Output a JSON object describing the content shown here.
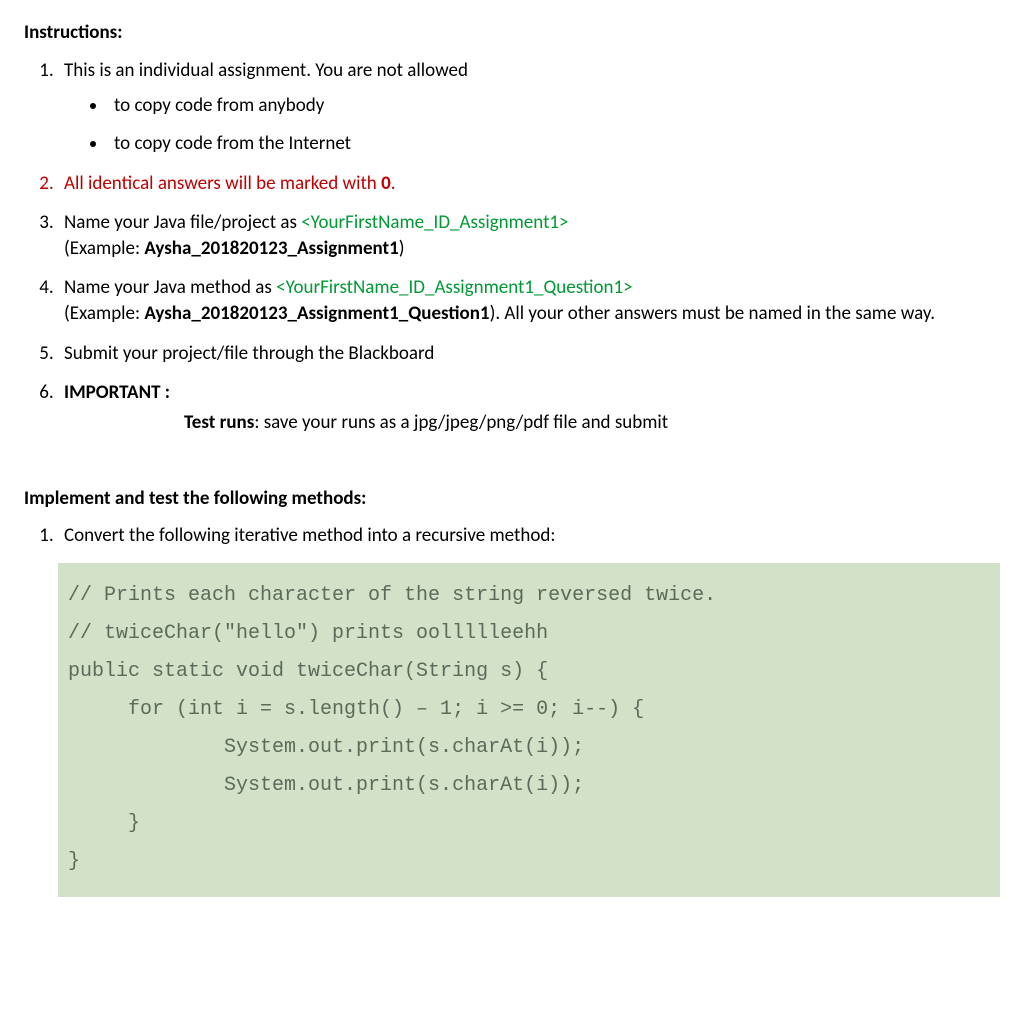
{
  "instructions_heading": "Instructions:",
  "item1": {
    "text": "This is an individual assignment. You are not allowed",
    "bullets": [
      "to copy code from anybody",
      "to copy code from the Internet"
    ]
  },
  "item2": {
    "prefix": "All identical answers will be marked with ",
    "bold": "0",
    "suffix": "."
  },
  "item3": {
    "prefix": "Name your Java file/project as ",
    "green": "<YourFirstName_ID_Assignment1>",
    "ex_open": "(Example: ",
    "ex_bold": "Aysha_201820123_Assignment1",
    "ex_close": ")"
  },
  "item4": {
    "prefix": "Name your Java method as ",
    "green": "<YourFirstName_ID_Assignment1_Question1>",
    "ex_open": "(Example: ",
    "ex_bold": "Aysha_201820123_Assignment1_Question1",
    "ex_close": "). All your other answers must be named in the same way."
  },
  "item5": "Submit your project/file through the Blackboard",
  "item6": {
    "label": "IMPORTANT :",
    "sub_bold": "Test runs",
    "sub_rest": ": save your runs as a jpg/jpeg/png/pdf file and submit"
  },
  "implement_heading": "Implement and test the following methods:",
  "task1": "Convert the following iterative method into a recursive method:",
  "code": "// Prints each character of the string reversed twice.\n// twiceChar(\"hello\") prints oollllleehh\npublic static void twiceChar(String s) {\n     for (int i = s.length() – 1; i >= 0; i--) {\n             System.out.print(s.charAt(i));\n             System.out.print(s.charAt(i));\n     }\n}"
}
